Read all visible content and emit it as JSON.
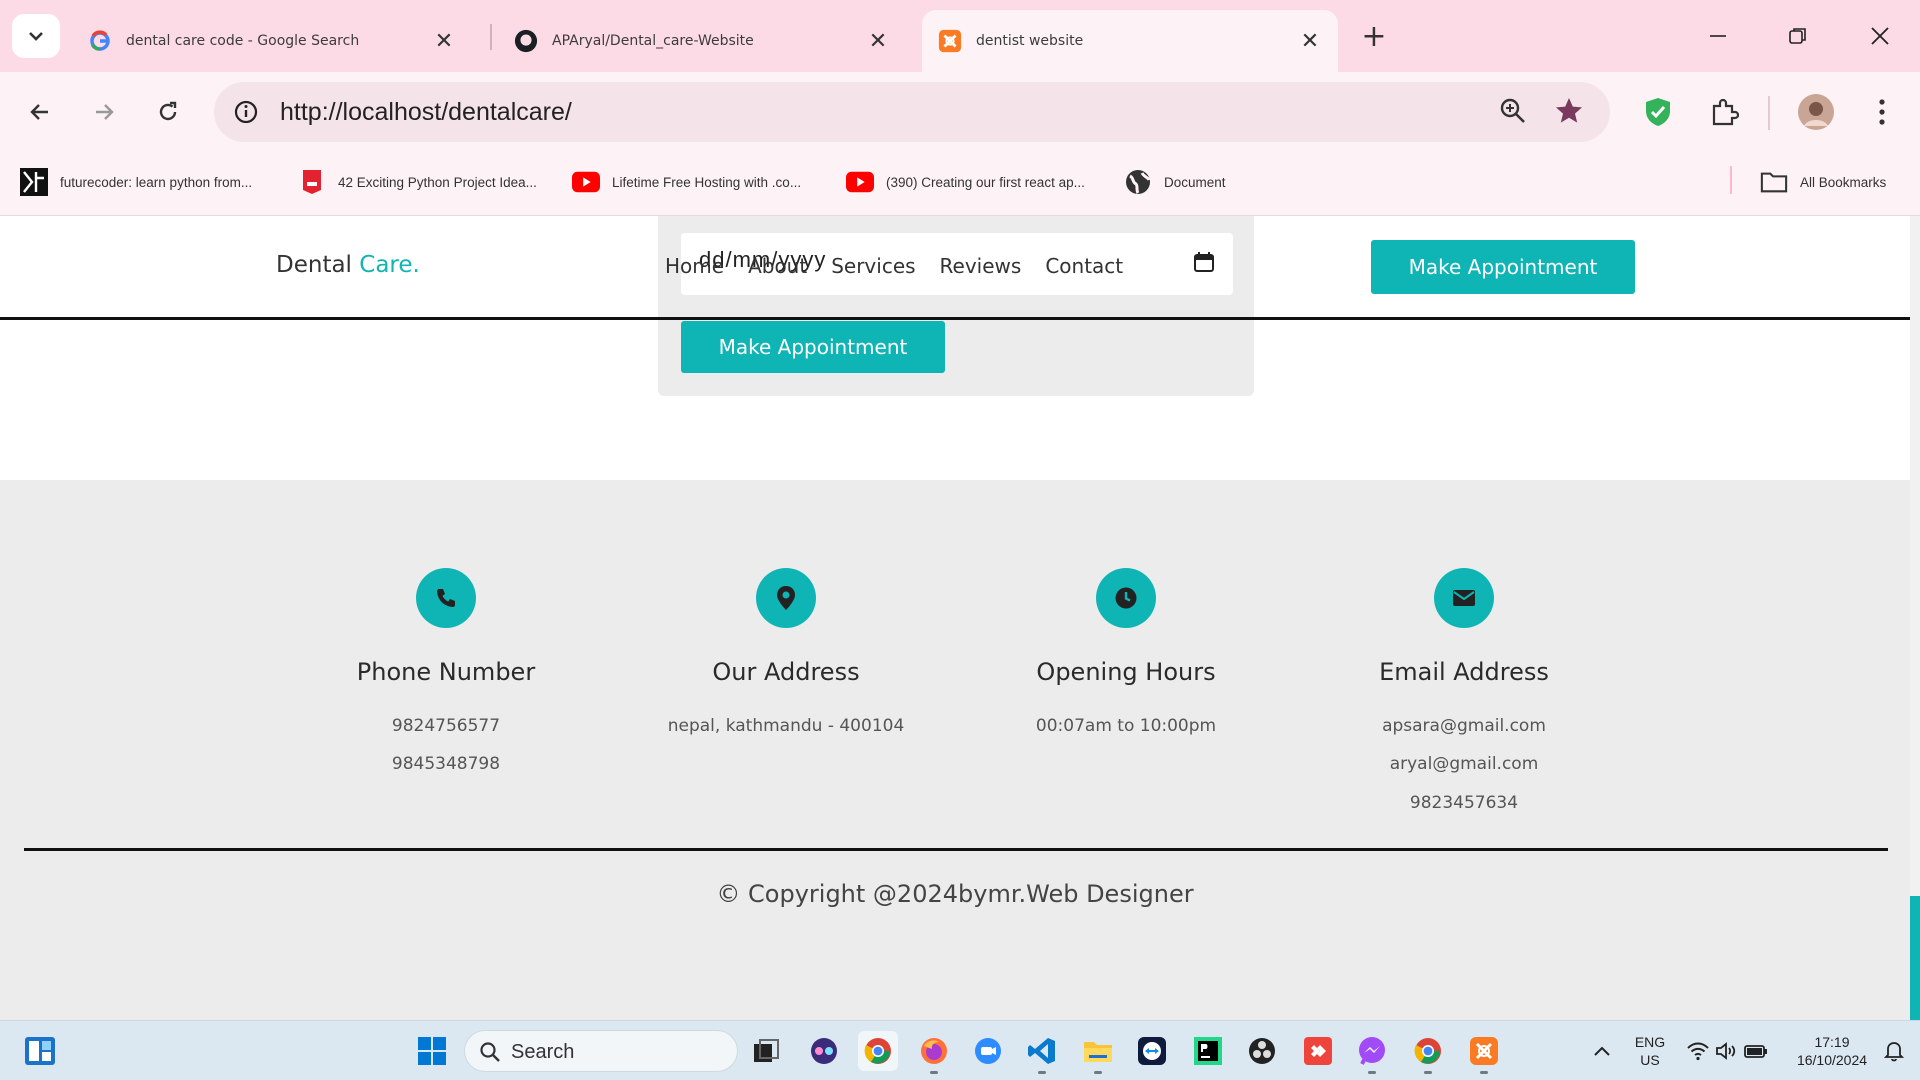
{
  "browser": {
    "tabs": [
      {
        "title": "dental care code - Google Search",
        "icon": "google-icon"
      },
      {
        "title": "APAryal/Dental_care-Website",
        "icon": "github-icon"
      },
      {
        "title": "dentist website",
        "icon": "xampp-icon",
        "active": true
      }
    ],
    "address": "http://localhost/dentalcare/",
    "bookmarks": [
      {
        "label": "futurecoder: learn python from...",
        "icon": "futurecoder-icon"
      },
      {
        "label": "42 Exciting Python Project Idea...",
        "icon": "bookmark-red-icon"
      },
      {
        "label": "Lifetime Free Hosting with .co...",
        "icon": "youtube-icon"
      },
      {
        "label": "(390) Creating our first react ap...",
        "icon": "youtube-icon"
      },
      {
        "label": "Document",
        "icon": "globe-icon"
      }
    ],
    "all_bookmarks": "All Bookmarks"
  },
  "page": {
    "appointment": {
      "date_placeholder": "dd/mm/yyyy",
      "button": "Make Appointment"
    },
    "header": {
      "logo_main": "Dental",
      "logo_accent": "Care.",
      "nav": [
        "Home",
        "About",
        "Services",
        "Reviews",
        "Contact"
      ],
      "cta": "Make Appointment"
    },
    "info": [
      {
        "title": "Phone Number",
        "icon": "phone-icon",
        "lines": [
          "9824756577",
          "9845348798"
        ]
      },
      {
        "title": "Our Address",
        "icon": "location-pin-icon",
        "lines": [
          "nepal, kathmandu - 400104"
        ]
      },
      {
        "title": "Opening Hours",
        "icon": "clock-icon",
        "lines": [
          "00:07am to 10:00pm"
        ]
      },
      {
        "title": "Email Address",
        "icon": "envelope-icon",
        "lines": [
          "apsara@gmail.com",
          "aryal@gmail.com",
          "9823457634"
        ]
      }
    ],
    "copyright": "© Copyright @2024bymr.Web Designer"
  },
  "taskbar": {
    "search_label": "Search",
    "language": "ENG",
    "region": "US",
    "time": "17:19",
    "date": "16/10/2024"
  },
  "colors": {
    "accent": "#0fb4b4",
    "tabstrip": "#fcdbe6"
  }
}
